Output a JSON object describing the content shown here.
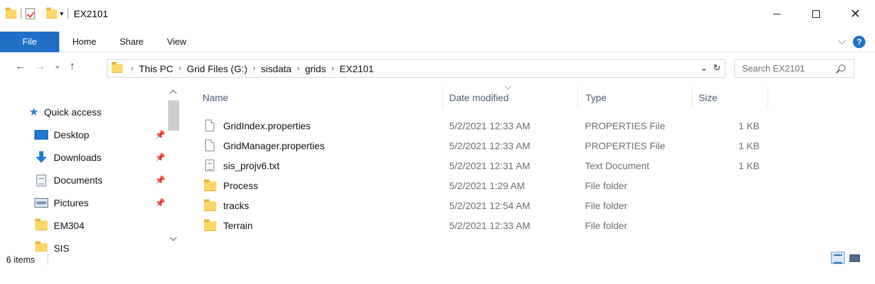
{
  "window": {
    "title": "EX2101",
    "controls": {
      "minimize": "—",
      "maximize": "☐",
      "close": "✕"
    }
  },
  "ribbon": {
    "tabs": [
      "File",
      "Home",
      "Share",
      "View"
    ],
    "help": "?"
  },
  "address": {
    "crumbs": [
      "This PC",
      "Grid Files (G:)",
      "sisdata",
      "grids",
      "EX2101"
    ],
    "refresh": "↻",
    "search_placeholder": "Search EX2101"
  },
  "nav": {
    "back": "←",
    "forward": "→",
    "recent": "⌄",
    "up": "↑"
  },
  "sidebar": {
    "items": [
      {
        "label": "Quick access",
        "icon": "star-icon"
      },
      {
        "label": "Desktop",
        "icon": "desktop-icon",
        "pinned": true
      },
      {
        "label": "Downloads",
        "icon": "downloads-icon",
        "pinned": true
      },
      {
        "label": "Documents",
        "icon": "documents-icon",
        "pinned": true
      },
      {
        "label": "Pictures",
        "icon": "pictures-icon",
        "pinned": true
      },
      {
        "label": "EM304",
        "icon": "folder-icon"
      },
      {
        "label": "SIS",
        "icon": "folder-icon"
      }
    ]
  },
  "columns": [
    "Name",
    "Date modified",
    "Type",
    "Size"
  ],
  "files": [
    {
      "name": "GridIndex.properties",
      "date": "5/2/2021 12:33 AM",
      "type": "PROPERTIES File",
      "size": "1 KB",
      "icon": "file-icon"
    },
    {
      "name": "GridManager.properties",
      "date": "5/2/2021 12:33 AM",
      "type": "PROPERTIES File",
      "size": "1 KB",
      "icon": "file-icon"
    },
    {
      "name": "sis_projv6.txt",
      "date": "5/2/2021 12:31 AM",
      "type": "Text Document",
      "size": "1 KB",
      "icon": "text-icon"
    },
    {
      "name": "Process",
      "date": "5/2/2021 1:29 AM",
      "type": "File folder",
      "size": "",
      "icon": "folder-icon"
    },
    {
      "name": "tracks",
      "date": "5/2/2021 12:54 AM",
      "type": "File folder",
      "size": "",
      "icon": "folder-icon"
    },
    {
      "name": "Terrain",
      "date": "5/2/2021 12:33 AM",
      "type": "File folder",
      "size": "",
      "icon": "folder-icon"
    }
  ],
  "status": {
    "count": "6 items"
  },
  "colors": {
    "accent": "#1f6fc5",
    "folder": "#ffd766",
    "header_text": "#4a5a75"
  }
}
